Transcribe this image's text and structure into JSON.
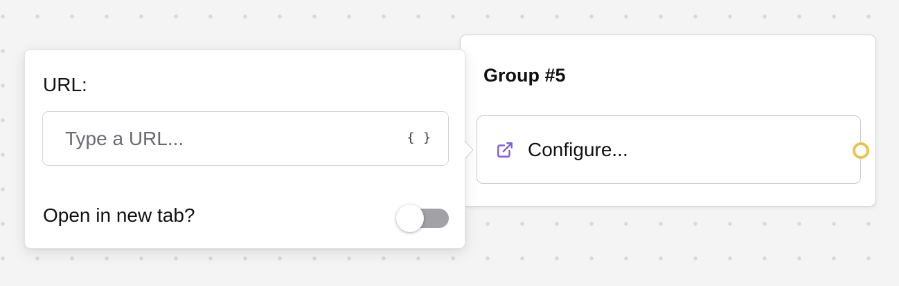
{
  "group": {
    "title": "Group #5",
    "block": {
      "label": "Configure...",
      "icon": "external-link-icon"
    },
    "handle_color": "#e8c44f"
  },
  "settings": {
    "url_label": "URL:",
    "url_value": "",
    "url_placeholder": "Type a URL...",
    "variable_button": "{ }",
    "new_tab_label": "Open in new tab?",
    "new_tab_enabled": false
  },
  "colors": {
    "accent": "#7c5ce0",
    "handle": "#e8c44f",
    "toggle_off": "#a1a1a6"
  }
}
